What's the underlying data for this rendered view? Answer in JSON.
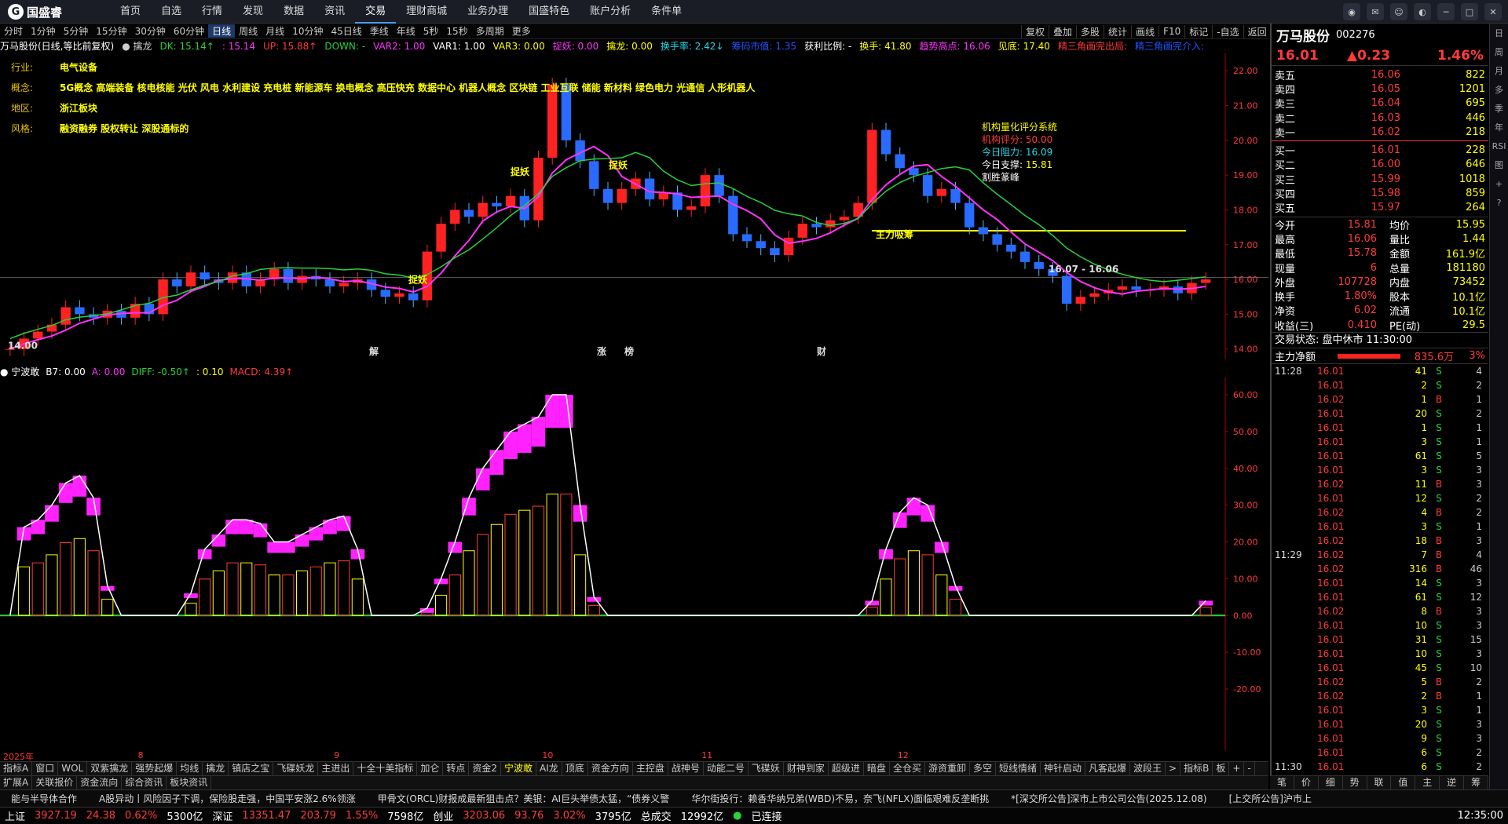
{
  "app": {
    "logo": "国盛睿",
    "nav": [
      "首页",
      "自选",
      "行情",
      "发现",
      "数据",
      "资讯",
      "交易",
      "理财商城",
      "业务办理",
      "国盛特色",
      "账户分析",
      "条件单"
    ],
    "active_nav": "交易",
    "window_controls": [
      "min",
      "max",
      "close"
    ]
  },
  "periods": [
    "分时",
    "1分钟",
    "5分钟",
    "15分钟",
    "30分钟",
    "60分钟",
    "日线",
    "周线",
    "月线",
    "10分钟",
    "45日线",
    "季线",
    "年线",
    "5秒",
    "15秒",
    "多周期",
    "更多"
  ],
  "active_period": "日线",
  "tools": [
    "复权",
    "叠加",
    "多股",
    "统计",
    "画线",
    "F10",
    "标记",
    "-自选",
    "返回"
  ],
  "main_header": [
    {
      "t": "万马股份(日线,等比前复权)",
      "c": "#fff"
    },
    {
      "t": "● 擒龙",
      "c": "#ccc"
    },
    {
      "t": "DK: 15.14↑",
      "c": "#27d23b"
    },
    {
      "t": ": 15.14",
      "c": "#ff33ff"
    },
    {
      "t": "UP: 15.88↑",
      "c": "#ff3b3b"
    },
    {
      "t": "DOWN: -",
      "c": "#27d23b"
    },
    {
      "t": "VAR2: 1.00",
      "c": "#ff33ff"
    },
    {
      "t": "VAR1: 1.00",
      "c": "#fff"
    },
    {
      "t": "VAR3: 0.00",
      "c": "#ffff00"
    },
    {
      "t": "捉妖: 0.00",
      "c": "#ff33ff"
    },
    {
      "t": "擒龙: 0.00",
      "c": "#ffff00"
    },
    {
      "t": "换手率: 2.42↓",
      "c": "#22d9e8"
    },
    {
      "t": "筹码市值: 1.35",
      "c": "#2255ff"
    },
    {
      "t": "获利比例: -",
      "c": "#fff"
    },
    {
      "t": "换手: 41.80",
      "c": "#ffff00"
    },
    {
      "t": "趋势高点: 16.06",
      "c": "#ff33ff"
    },
    {
      "t": "见底: 17.40",
      "c": "#ffff00"
    },
    {
      "t": "精三角画完出局:",
      "c": "#ff3b3b"
    },
    {
      "t": "精三角画完介入:",
      "c": "#2255ff"
    }
  ],
  "info": {
    "industry_k": "行业:",
    "industry": "电气设备",
    "concept_k": "概念:",
    "concept": "5G概念 高端装备 核电核能 光伏 风电 水利建设 充电桩 新能源车 换电概念 高压快充 数据中心 机器人概念 区块链 工业互联 储能 新材料 绿色电力 光通信 人形机器人",
    "region_k": "地区:",
    "region": "浙江板块",
    "style_k": "风格:",
    "style": "融资融券 股权转让 深股通标的"
  },
  "score": {
    "title": "机构量化评分系统",
    "l1": "机构评分:",
    "v1": "50.00",
    "l2": "今日阻力:",
    "v2": "16.09",
    "l3": "今日支撑:",
    "v3": "15.81",
    "tag": "割胜篆峰"
  },
  "chart_data": [
    {
      "type": "candlestick",
      "title": "万马股份(日线,等比前复权)",
      "y_ticks": [
        14,
        15,
        16,
        17,
        18,
        19,
        20,
        21,
        22
      ],
      "ylim": [
        13.7,
        22.5
      ],
      "annotations": [
        "捉妖",
        "捉妖",
        "捉妖",
        "主力吸筹",
        "16.07 - 16.06",
        "14.00",
        "解",
        "涨",
        "榜",
        "财"
      ],
      "x_labels": [
        "2025年",
        "8",
        "9",
        "10",
        "11",
        "12"
      ],
      "close": [
        14.0,
        14.3,
        14.5,
        14.7,
        15.2,
        15.0,
        14.9,
        15.1,
        14.9,
        15.3,
        15.0,
        16.0,
        15.8,
        16.2,
        16.0,
        15.9,
        16.2,
        15.8,
        16.0,
        16.3,
        15.9,
        16.1,
        16.0,
        15.8,
        15.9,
        16.0,
        15.7,
        15.5,
        15.6,
        15.4,
        16.8,
        17.6,
        18.0,
        17.8,
        18.2,
        18.1,
        18.4,
        17.7,
        19.5,
        21.6,
        20.0,
        19.4,
        18.6,
        18.2,
        18.6,
        18.9,
        18.3,
        18.5,
        18.0,
        18.1,
        19.0,
        18.4,
        17.3,
        17.1,
        16.9,
        16.7,
        17.2,
        17.6,
        17.5,
        17.7,
        17.8,
        18.2,
        20.3,
        19.6,
        19.2,
        19.0,
        18.4,
        18.6,
        18.2,
        17.5,
        17.3,
        17.0,
        16.8,
        16.5,
        16.3,
        16.1,
        15.3,
        15.5,
        15.6,
        15.7,
        15.8,
        15.7,
        15.7,
        15.8,
        15.6,
        15.9,
        16.0
      ]
    },
    {
      "type": "bar",
      "title": "宁波敢",
      "y_ticks": [
        -20,
        -10,
        0,
        10,
        20,
        30,
        40,
        50,
        60
      ],
      "ylim": [
        -20,
        60
      ],
      "series": [
        {
          "name": "B7",
          "values": [
            0,
            24,
            26,
            30,
            36,
            38,
            32,
            8,
            0,
            0,
            0,
            0,
            0,
            6,
            18,
            22,
            26,
            26,
            25,
            20,
            20,
            22,
            24,
            26,
            27,
            18,
            0,
            0,
            0,
            0,
            2,
            10,
            20,
            32,
            40,
            45,
            50,
            52,
            54,
            60,
            60,
            30,
            5,
            0,
            0,
            0,
            0,
            0,
            0,
            0,
            0,
            0,
            0,
            0,
            0,
            0,
            0,
            0,
            0,
            0,
            0,
            0,
            4,
            18,
            28,
            32,
            30,
            20,
            8,
            0,
            0,
            0,
            0,
            0,
            0,
            0,
            0,
            0,
            0,
            0,
            0,
            0,
            0,
            0,
            0,
            0,
            4
          ]
        }
      ]
    }
  ],
  "sub_header": [
    {
      "t": "● 宁波敢",
      "c": "#fff"
    },
    {
      "t": "B7: 0.00",
      "c": "#fff"
    },
    {
      "t": "A: 0.00",
      "c": "#ff33ff"
    },
    {
      "t": "DIFF: -0.50↑",
      "c": "#27d23b"
    },
    {
      "t": ": 0.10",
      "c": "#ffff00"
    },
    {
      "t": "MACD: 4.39↑",
      "c": "#ff3b3b"
    }
  ],
  "dates": [
    "2025年",
    "8",
    "9",
    "10",
    "11",
    "12"
  ],
  "indicator_tabs": [
    "指标A",
    "窗口",
    "WOL",
    "双紫擒龙",
    "强势起爆",
    "均线",
    "擒龙",
    "镇店之宝",
    "飞碟妖龙",
    "主进出",
    "十全十美指标",
    "加仑",
    "转点",
    "资金2",
    "宁波敢",
    "AI龙",
    "顶底",
    "资金方向",
    "主控盘",
    "战神号",
    "动能二号",
    "飞碟妖",
    "财神到家",
    "超级进",
    "暗盘",
    "全仓买",
    "游资重卸",
    "多空",
    "短线情绪",
    "神针启动",
    "凡客起爆",
    "波段王",
    ">",
    "指标B",
    "板",
    "+",
    "-"
  ],
  "active_tab": "宁波敢",
  "bottom_tabs": [
    "扩展A",
    "关联报价",
    "资金流向",
    "综合资讯",
    "板块资讯"
  ],
  "news": [
    "能与半导体合作",
    "A股异动丨风险因子下调，保险股走强，中国平安涨2.6%领涨",
    "甲骨文(ORCL)财报成最新狙击点？美银：AI巨头举债太猛，“债券义警",
    "华尔街投行：赖香华纳兄弟(WBD)不易，奈飞(NFLX)面临艰难反垄断挑",
    "*[深交所公告]深市上市公司公告(2025.12.08)",
    "[上交所公告]沪市上"
  ],
  "status": {
    "sh_label": "上证",
    "sh": "3927.19",
    "sh_chg": "24.38",
    "sh_pct": "0.62%",
    "sh_amt": "5300亿",
    "sz_label": "深证",
    "sz": "13351.47",
    "sz_chg": "203.79",
    "sz_pct": "1.55%",
    "sz_amt": "7598亿",
    "cy_label": "创业",
    "cy": "3203.06",
    "cy_chg": "93.76",
    "cy_pct": "3.02%",
    "cy_amt": "3795亿",
    "total_label": "总成交",
    "total": "12992亿",
    "conn": "已连接",
    "time": "12:35:00"
  },
  "quote": {
    "name": "万马股份",
    "code": "002276",
    "price": "16.01",
    "chg": "▲0.23",
    "pct": "1.46%",
    "asks": [
      [
        "卖五",
        "16.06",
        "822"
      ],
      [
        "卖四",
        "16.05",
        "1201"
      ],
      [
        "卖三",
        "16.04",
        "695"
      ],
      [
        "卖二",
        "16.03",
        "446"
      ],
      [
        "卖一",
        "16.02",
        "218"
      ]
    ],
    "bids": [
      [
        "买一",
        "16.01",
        "228"
      ],
      [
        "买二",
        "16.00",
        "646"
      ],
      [
        "买三",
        "15.99",
        "1018"
      ],
      [
        "买四",
        "15.98",
        "859"
      ],
      [
        "买五",
        "15.97",
        "264"
      ]
    ],
    "stats": [
      [
        "今开",
        "15.81",
        "均价",
        "15.95"
      ],
      [
        "最高",
        "16.06",
        "量比",
        "1.44"
      ],
      [
        "最低",
        "15.78",
        "金额",
        "161.9亿"
      ],
      [
        "现量",
        "6",
        "总量",
        "181180"
      ],
      [
        "外盘",
        "107728",
        "内盘",
        "73452"
      ],
      [
        "换手",
        "1.80%",
        "股本",
        "10.1亿"
      ],
      [
        "净资",
        "6.02",
        "流通",
        "10.1亿"
      ],
      [
        "收益(三)",
        "0.410",
        "PE(动)",
        "29.5"
      ]
    ],
    "trade_state": "交易状态: 盘中休市 11:30:00",
    "main_flow_label": "主力净额",
    "main_flow": "835.6万",
    "main_flow_pct": "3%",
    "ticks": [
      [
        "11:28",
        "16.01",
        "41",
        "S",
        "4"
      ],
      [
        "",
        "16.01",
        "2",
        "S",
        "2"
      ],
      [
        "",
        "16.02",
        "1",
        "B",
        "1"
      ],
      [
        "",
        "16.01",
        "20",
        "S",
        "2"
      ],
      [
        "",
        "16.01",
        "1",
        "S",
        "1"
      ],
      [
        "",
        "16.01",
        "3",
        "S",
        "1"
      ],
      [
        "",
        "16.01",
        "61",
        "S",
        "5"
      ],
      [
        "",
        "16.01",
        "3",
        "S",
        "3"
      ],
      [
        "",
        "16.02",
        "11",
        "B",
        "3"
      ],
      [
        "",
        "16.01",
        "12",
        "S",
        "2"
      ],
      [
        "",
        "16.02",
        "4",
        "B",
        "2"
      ],
      [
        "",
        "16.01",
        "3",
        "S",
        "1"
      ],
      [
        "",
        "16.02",
        "18",
        "B",
        "3"
      ],
      [
        "11:29",
        "16.02",
        "7",
        "B",
        "4"
      ],
      [
        "",
        "16.02",
        "316",
        "B",
        "46"
      ],
      [
        "",
        "16.01",
        "14",
        "S",
        "3"
      ],
      [
        "",
        "16.01",
        "61",
        "S",
        "12"
      ],
      [
        "",
        "16.02",
        "8",
        "B",
        "3"
      ],
      [
        "",
        "16.01",
        "10",
        "S",
        "3"
      ],
      [
        "",
        "16.01",
        "31",
        "S",
        "15"
      ],
      [
        "",
        "16.01",
        "10",
        "S",
        "3"
      ],
      [
        "",
        "16.01",
        "45",
        "S",
        "10"
      ],
      [
        "",
        "16.02",
        "5",
        "B",
        "2"
      ],
      [
        "",
        "16.02",
        "2",
        "B",
        "1"
      ],
      [
        "",
        "16.01",
        "3",
        "S",
        "1"
      ],
      [
        "",
        "16.01",
        "20",
        "S",
        "3"
      ],
      [
        "",
        "16.01",
        "9",
        "S",
        "3"
      ],
      [
        "",
        "16.01",
        "6",
        "S",
        "2"
      ],
      [
        "11:30",
        "16.01",
        "6",
        "S",
        "2"
      ]
    ],
    "rtabs": [
      "笔",
      "价",
      "细",
      "势",
      "联",
      "值",
      "主",
      "逆",
      "筹"
    ]
  },
  "side_icons": [
    "日",
    "周",
    "月",
    "多",
    "季",
    "年",
    "RSI",
    "图",
    "+",
    "?"
  ]
}
